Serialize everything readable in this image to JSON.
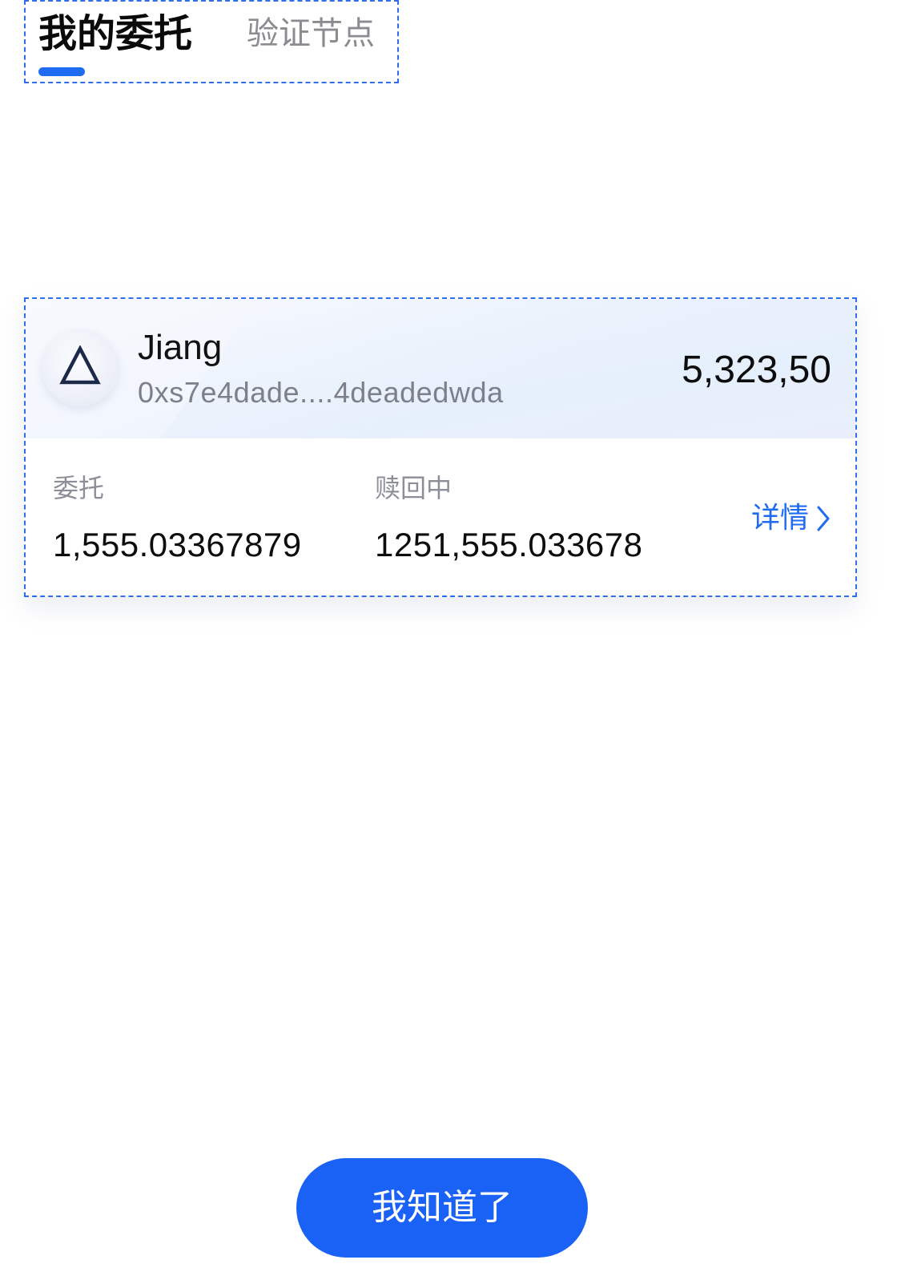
{
  "tabs": [
    {
      "label": "我的委托",
      "active": true
    },
    {
      "label": "验证节点",
      "active": false
    }
  ],
  "validator": {
    "name": "Jiang",
    "address": "0xs7e4dade....4deadedwda",
    "amount": "5,323,50",
    "icon": "triangle-logo-icon"
  },
  "stats": {
    "delegated": {
      "label": "委托",
      "value": "1,555.03367879"
    },
    "redeeming": {
      "label": "赎回中",
      "value": "1251,555.033678"
    }
  },
  "details_link": {
    "label": "详情",
    "icon": "chevron-right-icon"
  },
  "confirm_button": {
    "label": "我知道了"
  },
  "colors": {
    "accent": "#1f6bf2",
    "button": "#1a62f5",
    "text_primary": "#0d0d0d",
    "text_secondary": "#8c8f98"
  }
}
